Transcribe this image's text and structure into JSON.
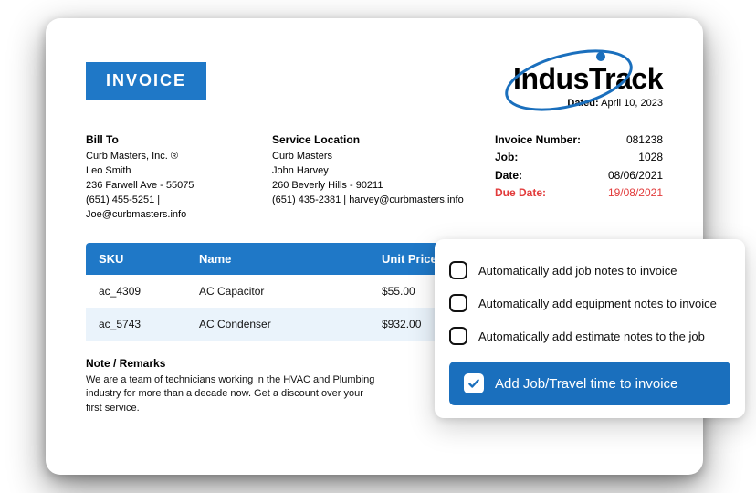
{
  "badge": "INVOICE",
  "brand": {
    "name": "IndusTrack",
    "dated_label": "Dated:",
    "dated_value": "April 10, 2023"
  },
  "bill_to": {
    "heading": "Bill To",
    "company": "Curb Masters, Inc. ®",
    "name": "Leo Smith",
    "address": "236 Farwell Ave - 55075",
    "contact": "(651) 455-5251 | Joe@curbmasters.info"
  },
  "service": {
    "heading": "Service Location",
    "company": "Curb Masters",
    "name": "John Harvey",
    "address": "260 Beverly Hills - 90211",
    "contact": "(651) 435-2381 | harvey@curbmasters.info"
  },
  "meta": {
    "invoice_number_label": "Invoice Number:",
    "invoice_number": "081238",
    "job_label": "Job:",
    "job": "1028",
    "date_label": "Date:",
    "date": "08/06/2021",
    "due_label": "Due Date:",
    "due": "19/08/2021"
  },
  "table": {
    "headers": {
      "sku": "SKU",
      "name": "Name",
      "price": "Unit Price"
    },
    "rows": [
      {
        "sku": "ac_4309",
        "name": "AC Capacitor",
        "price": "$55.00"
      },
      {
        "sku": "ac_5743",
        "name": "AC Condenser",
        "price": "$932.00"
      }
    ]
  },
  "notes": {
    "heading": "Note / Remarks",
    "body": "We are a team of technicians working in the HVAC and Plumbing industry for more than a decade now. Get a discount over your first service."
  },
  "panel": {
    "options": [
      "Automatically add job notes to invoice",
      "Automatically add equipment notes to invoice",
      "Automatically add estimate notes to the job"
    ],
    "cta": "Add Job/Travel time to invoice"
  }
}
